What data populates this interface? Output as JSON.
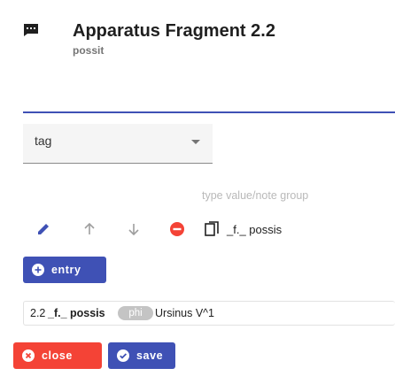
{
  "header": {
    "icon": "comment-icon",
    "title": "Apparatus Fragment 2.2",
    "subtitle": "possit"
  },
  "form": {
    "tag_select_value": "tag",
    "value_placeholder": "type value/note group"
  },
  "toolbar": {
    "icons": [
      "edit-icon",
      "arrow-up-icon",
      "arrow-down-icon",
      "remove-icon",
      "copy-icon"
    ],
    "text": "_f._ possis"
  },
  "buttons": {
    "entry": "entry",
    "close": "close",
    "save": "save"
  },
  "entries": [
    {
      "ref": "2.2",
      "lemma": "_f._ possis",
      "badge": "phi",
      "witness": "Ursinus V^1"
    }
  ],
  "colors": {
    "primary": "#3f51b5",
    "danger": "#f44336",
    "remove": "#f44336",
    "pill": "#c4c4c4"
  }
}
